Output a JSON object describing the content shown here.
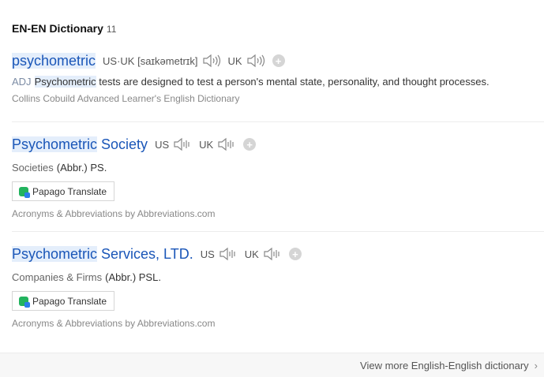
{
  "section": {
    "title": "EN-EN Dictionary",
    "count": "11"
  },
  "entries": [
    {
      "headword_hl": "psychometric",
      "headword_rest": "",
      "pron_us_label": "US·UK [saɪkəmetrɪk]",
      "pron_uk_label": "UK",
      "pos": "ADJ",
      "def_hl": "Psychometric",
      "def_rest": " tests are designed to test a person's mental state, personality, and thought processes.",
      "source": "Collins Cobuild Advanced Learner's English Dictionary"
    },
    {
      "headword_hl": "Psychometric",
      "headword_rest": " Society",
      "pron_us_label": "US",
      "pron_uk_label": "UK",
      "category": "Societies",
      "abbr": "(Abbr.) PS.",
      "button_label": "Papago Translate",
      "source": "Acronyms & Abbreviations by Abbreviations.com"
    },
    {
      "headword_hl": "Psychometric",
      "headword_rest": " Services, LTD.",
      "pron_us_label": "US",
      "pron_uk_label": "UK",
      "category": "Companies & Firms",
      "abbr": "(Abbr.) PSL.",
      "button_label": "Papago Translate",
      "source": "Acronyms & Abbreviations by Abbreviations.com"
    }
  ],
  "footer": {
    "link_label": "View more English-English dictionary"
  },
  "icons": {
    "speaker": "speaker-icon",
    "add": "plus-icon",
    "papago": "papago-logo-icon",
    "chevron": "chevron-right-icon"
  },
  "colors": {
    "headword": "#1a56b8",
    "highlight": "#e4eefb",
    "pos": "#7c8ca5"
  }
}
